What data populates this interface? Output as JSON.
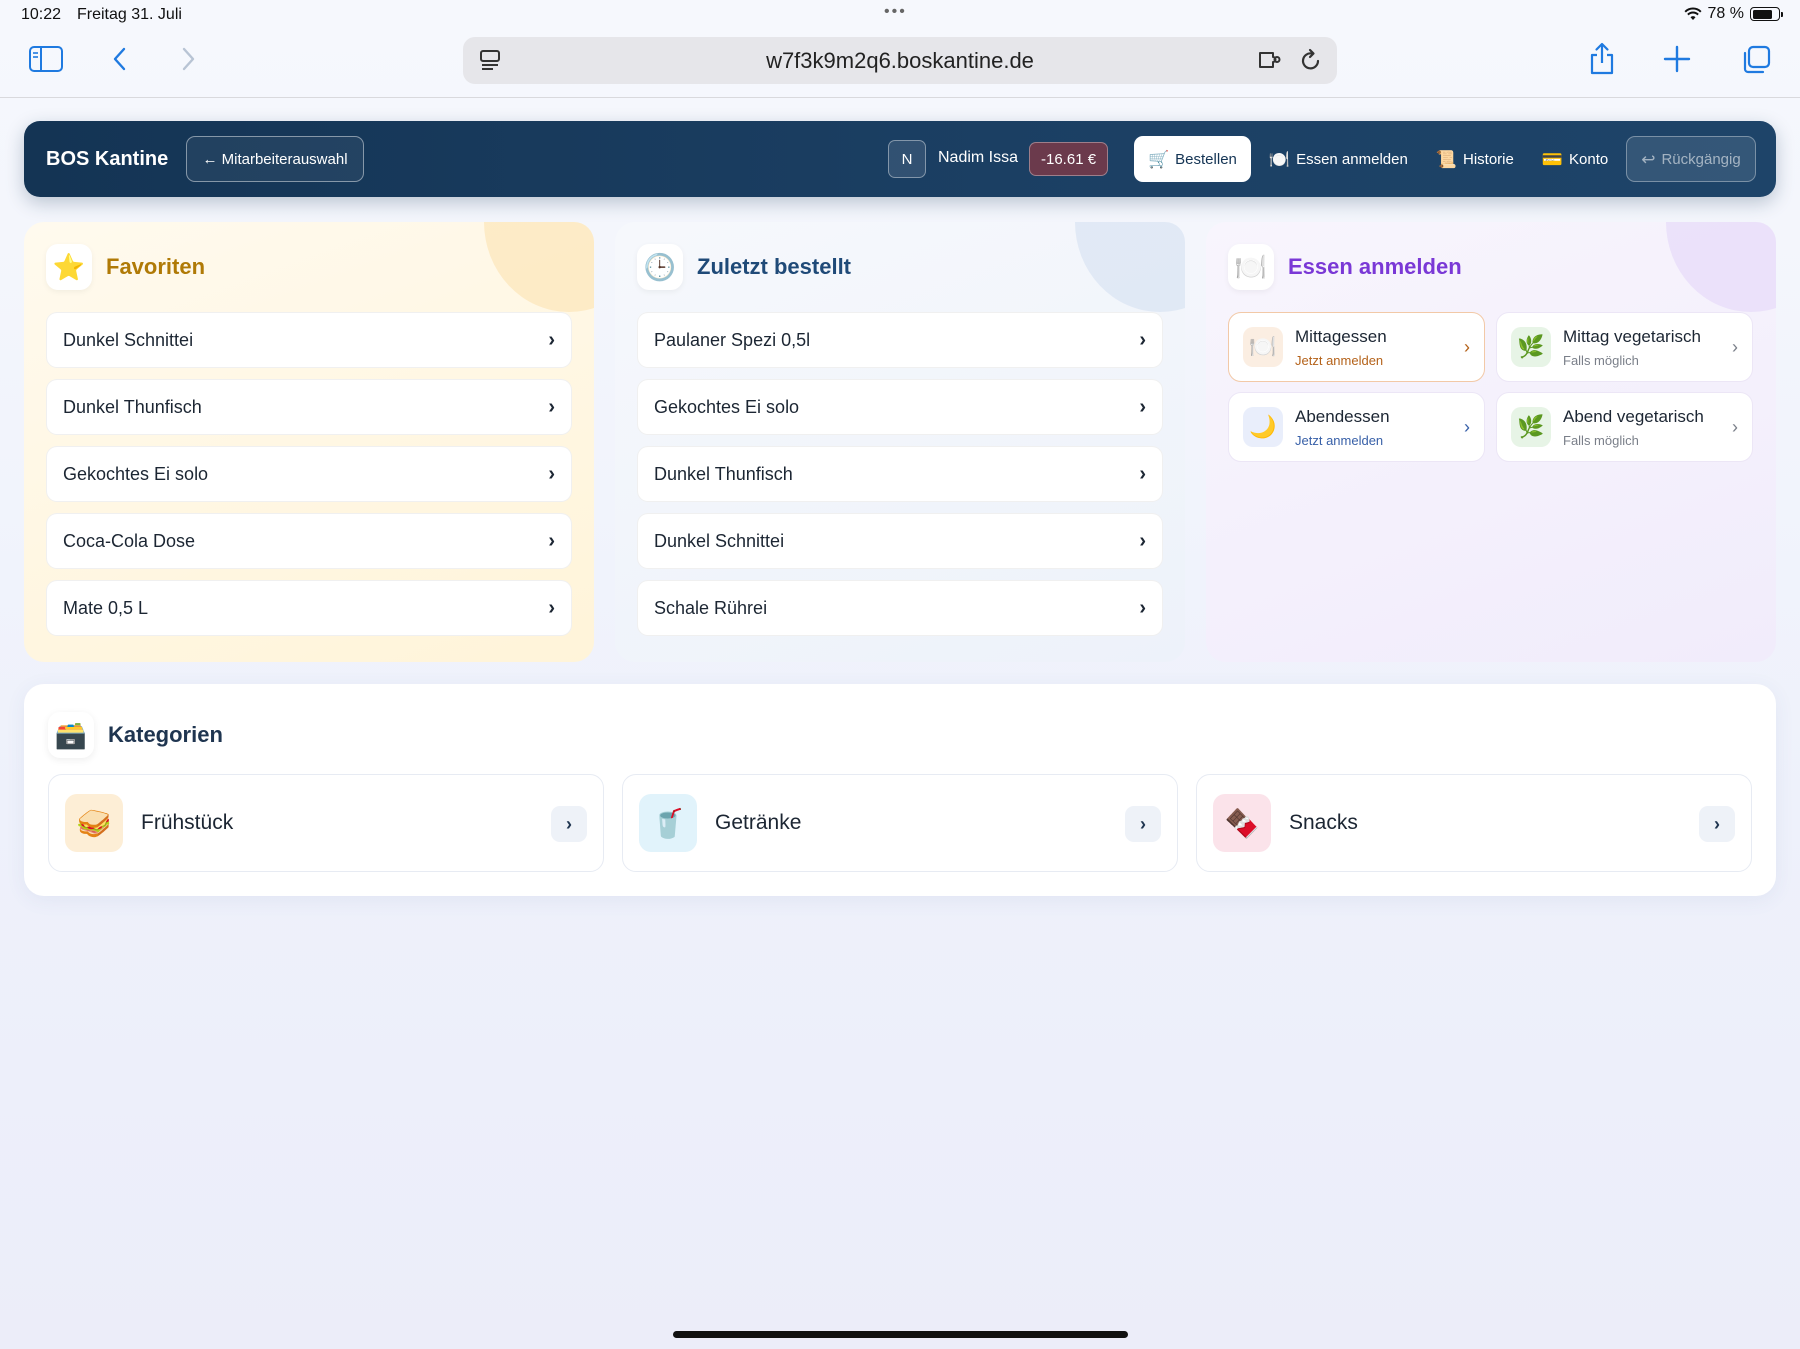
{
  "status_bar": {
    "time": "10:22",
    "date": "Freitag 31. Juli",
    "battery": "78 %",
    "battery_level": 0.78
  },
  "browser": {
    "url": "w7f3k9m2q6.boskantine.de"
  },
  "header": {
    "brand": "BOS Kantine",
    "back_label": "← Mitarbeiterauswahl",
    "avatar_initial": "N",
    "user_name": "Nadim Issa",
    "balance": "-16.61 €",
    "nav": [
      {
        "icon": "cart-icon",
        "glyph": "🛒",
        "label": "Bestellen"
      },
      {
        "icon": "plate-icon",
        "glyph": "🍽️",
        "label": "Essen anmelden"
      },
      {
        "icon": "history-icon",
        "glyph": "📜",
        "label": "Historie"
      },
      {
        "icon": "card-icon",
        "glyph": "💳",
        "label": "Konto"
      },
      {
        "icon": "undo-icon",
        "glyph": "↩",
        "label": "Rückgängig"
      }
    ]
  },
  "favorites": {
    "title": "Favoriten",
    "icon": "star-icon",
    "items": [
      "Dunkel Schnittei",
      "Dunkel Thunfisch",
      "Gekochtes Ei solo",
      "Coca-Cola Dose",
      "Mate 0,5 L"
    ]
  },
  "recent": {
    "title": "Zuletzt bestellt",
    "icon": "clock-icon",
    "items": [
      "Paulaner Spezi 0,5l",
      "Gekochtes Ei solo",
      "Dunkel Thunfisch",
      "Dunkel Schnittei",
      "Schale Rührei"
    ]
  },
  "meals": {
    "title": "Essen anmelden",
    "icon": "plate-icon",
    "items": [
      {
        "name": "Mittagessen",
        "sub": "Jetzt anmelden",
        "icon": "plate-icon"
      },
      {
        "name": "Mittag vegetarisch",
        "sub": "Falls möglich",
        "icon": "leaf-icon"
      },
      {
        "name": "Abendessen",
        "sub": "Jetzt anmelden",
        "icon": "moon-icon"
      },
      {
        "name": "Abend vegetarisch",
        "sub": "Falls möglich",
        "icon": "leaf-icon"
      }
    ]
  },
  "categories": {
    "title": "Kategorien",
    "icon": "box-icon",
    "items": [
      {
        "name": "Frühstück",
        "icon": "sandwich-icon"
      },
      {
        "name": "Getränke",
        "icon": "drink-icon"
      },
      {
        "name": "Snacks",
        "icon": "chocolate-icon"
      }
    ]
  },
  "colors": {
    "header_bg": "#143454",
    "favorites_title": "#b07a06",
    "recent_title": "#1f4a78",
    "meals_title": "#7a38d6",
    "balance_bg": "#6b3a4c"
  }
}
